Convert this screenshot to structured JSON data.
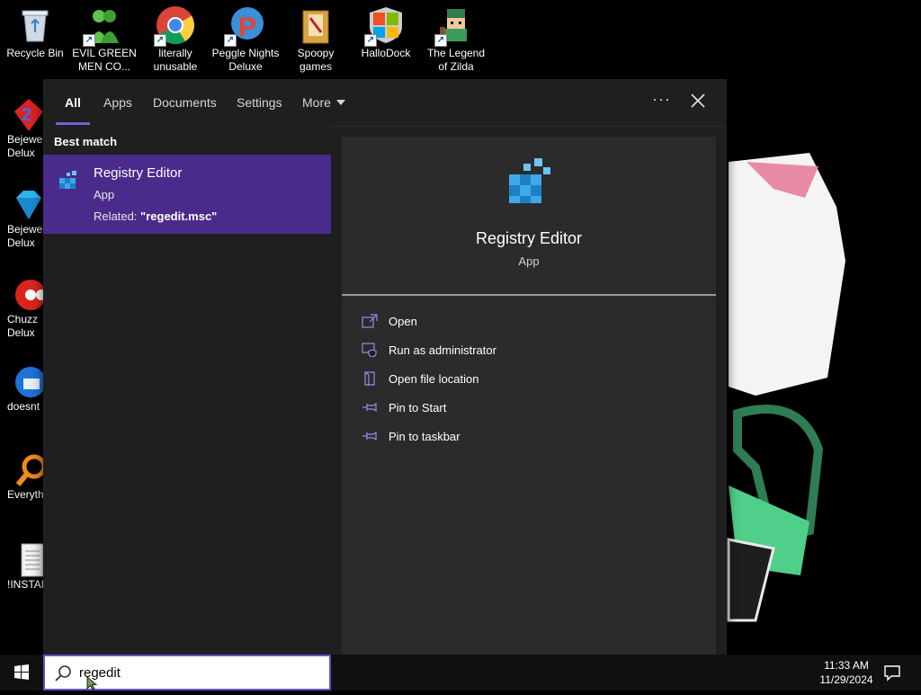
{
  "desktop": {
    "top_icons": [
      {
        "label": "Recycle Bin",
        "icon": "recycle-bin-icon"
      },
      {
        "label": "EVIL GREEN MEN CO...",
        "icon": "green-men-icon"
      },
      {
        "label": "literally unusable",
        "icon": "chrome-icon"
      },
      {
        "label": "Peggle Nights Deluxe",
        "icon": "peggle-icon"
      },
      {
        "label": "Spoopy games",
        "icon": "folder-icon"
      },
      {
        "label": "HalloDock",
        "icon": "windows-logo-icon"
      },
      {
        "label": "The Legend of Zilda",
        "icon": "zilda-icon"
      }
    ],
    "side_icons": [
      {
        "label": "Bejewel\nDelux",
        "icon": "bejeweled-2-icon"
      },
      {
        "label": "Bejewe\nDelux",
        "icon": "bejeweled-icon"
      },
      {
        "label": "Chuzz\nDelux",
        "icon": "chuzzle-icon"
      },
      {
        "label": "doesnt",
        "icon": "thunderbird-icon"
      },
      {
        "label": "Everyth",
        "icon": "everything-search-icon"
      },
      {
        "label": "!INSTALL",
        "icon": "text-file-icon"
      }
    ]
  },
  "search": {
    "tabs": [
      {
        "label": "All"
      },
      {
        "label": "Apps"
      },
      {
        "label": "Documents"
      },
      {
        "label": "Settings"
      },
      {
        "label": "More"
      }
    ],
    "best_match_heading": "Best match",
    "result": {
      "title": "Registry Editor",
      "type": "App",
      "related_prefix": "Related: ",
      "related_value": "\"regedit.msc\""
    },
    "detail": {
      "title": "Registry Editor",
      "subtitle": "App",
      "actions": [
        {
          "label": "Open",
          "icon": "open-icon"
        },
        {
          "label": "Run as administrator",
          "icon": "run-as-admin-icon"
        },
        {
          "label": "Open file location",
          "icon": "file-location-icon"
        },
        {
          "label": "Pin to Start",
          "icon": "pin-icon"
        },
        {
          "label": "Pin to taskbar",
          "icon": "pin-icon"
        }
      ]
    },
    "query": "regedit"
  },
  "taskbar": {
    "time": "11:33 AM",
    "date": "11/29/2024"
  },
  "colors": {
    "accent": "#7b5cd6",
    "result_highlight": "#4a2b8c",
    "flyout_bg": "#1f1f1f",
    "detail_bg": "#2b2b2b"
  }
}
